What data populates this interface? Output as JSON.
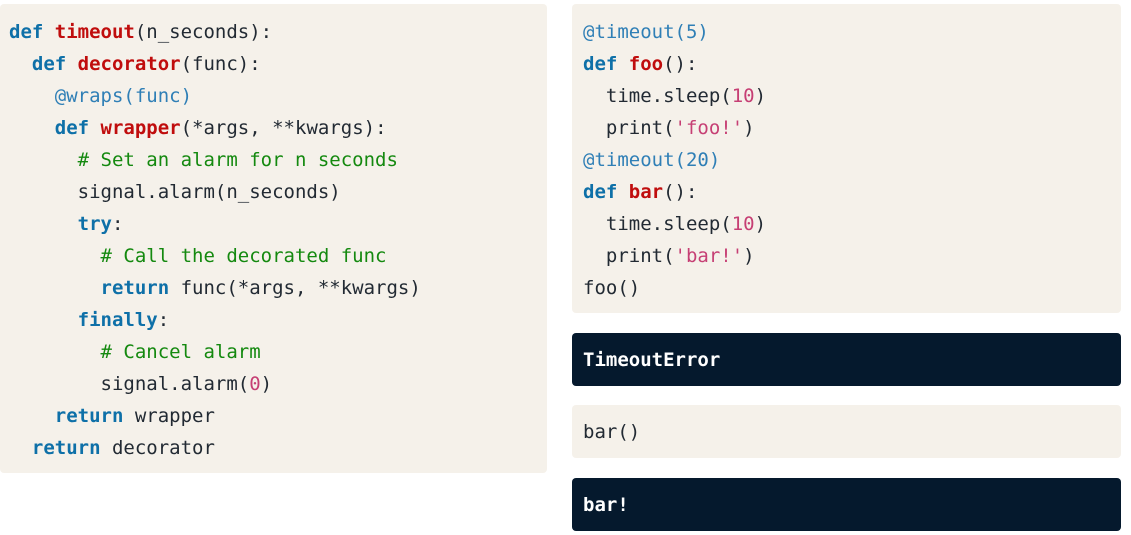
{
  "left_code": [
    [
      [
        "kw",
        "def "
      ],
      [
        "fn",
        "timeout"
      ],
      [
        "plain",
        "(n_seconds):"
      ]
    ],
    [
      [
        "plain",
        "  "
      ],
      [
        "kw",
        "def "
      ],
      [
        "fn",
        "decorator"
      ],
      [
        "plain",
        "(func):"
      ]
    ],
    [
      [
        "plain",
        "    "
      ],
      [
        "deco",
        "@wraps(func)"
      ]
    ],
    [
      [
        "plain",
        "    "
      ],
      [
        "kw",
        "def "
      ],
      [
        "fn",
        "wrapper"
      ],
      [
        "plain",
        "(*args, **kwargs):"
      ]
    ],
    [
      [
        "plain",
        "      "
      ],
      [
        "cm",
        "# Set an alarm for n seconds"
      ]
    ],
    [
      [
        "plain",
        "      signal.alarm(n_seconds)"
      ]
    ],
    [
      [
        "plain",
        "      "
      ],
      [
        "kw",
        "try"
      ],
      [
        "plain",
        ":"
      ]
    ],
    [
      [
        "plain",
        "        "
      ],
      [
        "cm",
        "# Call the decorated func"
      ]
    ],
    [
      [
        "plain",
        "        "
      ],
      [
        "kw",
        "return"
      ],
      [
        "plain",
        " func(*args, **kwargs)"
      ]
    ],
    [
      [
        "plain",
        "      "
      ],
      [
        "kw",
        "finally"
      ],
      [
        "plain",
        ":"
      ]
    ],
    [
      [
        "plain",
        "        "
      ],
      [
        "cm",
        "# Cancel alarm"
      ]
    ],
    [
      [
        "plain",
        "        signal.alarm("
      ],
      [
        "num",
        "0"
      ],
      [
        "plain",
        ")"
      ]
    ],
    [
      [
        "plain",
        "    "
      ],
      [
        "kw",
        "return"
      ],
      [
        "plain",
        " wrapper"
      ]
    ],
    [
      [
        "plain",
        "  "
      ],
      [
        "kw",
        "return"
      ],
      [
        "plain",
        " decorator"
      ]
    ]
  ],
  "right_code": [
    [
      [
        "deco",
        "@timeout(5)"
      ]
    ],
    [
      [
        "kw",
        "def "
      ],
      [
        "fn",
        "foo"
      ],
      [
        "plain",
        "():"
      ]
    ],
    [
      [
        "plain",
        "  time.sleep("
      ],
      [
        "num",
        "10"
      ],
      [
        "plain",
        ")"
      ]
    ],
    [
      [
        "plain",
        "  print("
      ],
      [
        "str",
        "'foo!'"
      ],
      [
        "plain",
        ")"
      ]
    ],
    [
      [
        "deco",
        "@timeout(20)"
      ]
    ],
    [
      [
        "kw",
        "def "
      ],
      [
        "fn",
        "bar"
      ],
      [
        "plain",
        "():"
      ]
    ],
    [
      [
        "plain",
        "  time.sleep("
      ],
      [
        "num",
        "10"
      ],
      [
        "plain",
        ")"
      ]
    ],
    [
      [
        "plain",
        "  print("
      ],
      [
        "str",
        "'bar!'"
      ],
      [
        "plain",
        ")"
      ]
    ],
    [
      [
        "plain",
        "foo()"
      ]
    ]
  ],
  "output_1": "TimeoutError",
  "call_2": "bar()",
  "output_2": "bar!"
}
